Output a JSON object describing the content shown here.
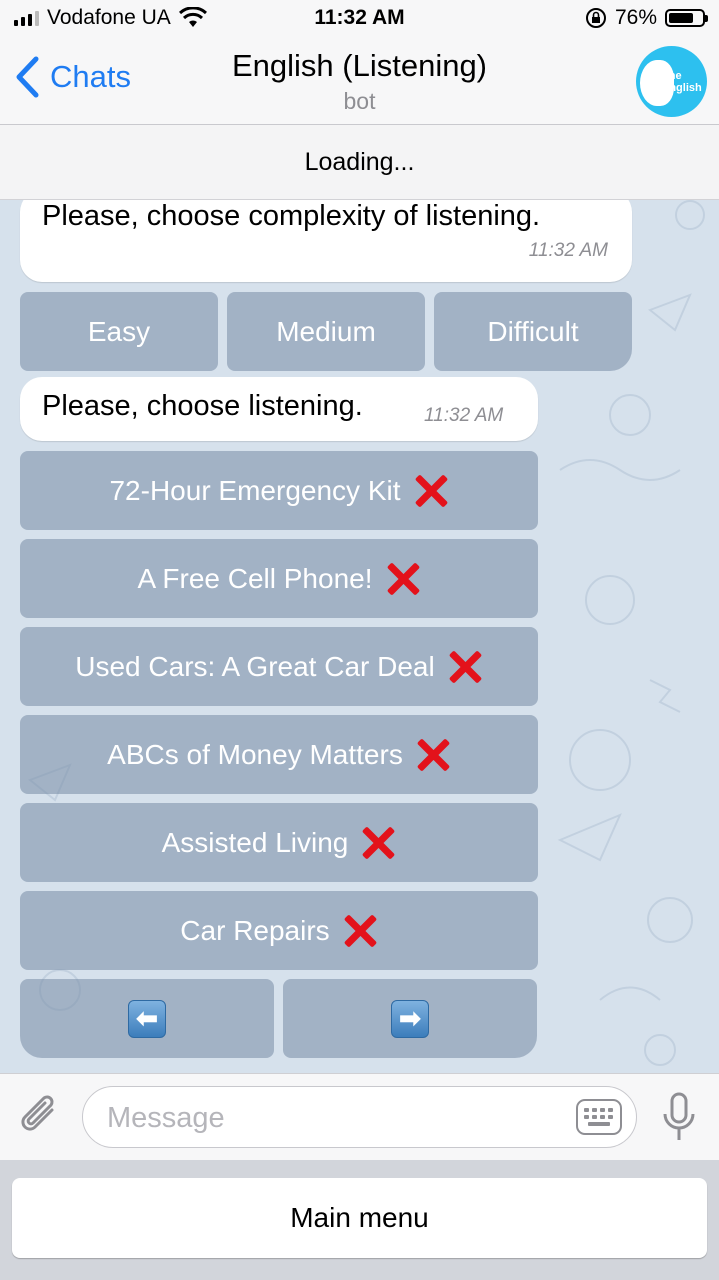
{
  "status_bar": {
    "carrier": "Vodafone UA",
    "time": "11:32 AM",
    "battery": "76%",
    "battery_level": 0.76
  },
  "nav": {
    "back_label": "Chats",
    "title": "English (Listening)",
    "subtitle": "bot",
    "avatar_text_1": "The",
    "avatar_text_2": "English"
  },
  "loading_text": "Loading...",
  "messages": [
    {
      "text": "Please, choose complexity of listening.",
      "time": "11:32 AM"
    },
    {
      "text": "Please, choose listening.",
      "time": "11:32 AM"
    }
  ],
  "complexity_buttons": [
    "Easy",
    "Medium",
    "Difficult"
  ],
  "listening_buttons": [
    "72-Hour Emergency Kit",
    "A Free Cell Phone!",
    "Used Cars: A Great Car Deal",
    "ABCs of Money Matters",
    "Assisted Living",
    "Car Repairs"
  ],
  "nav_buttons": {
    "prev_icon": "left-arrow-icon",
    "next_icon": "right-arrow-icon",
    "prev_glyph": "⬅",
    "next_glyph": "➡"
  },
  "input": {
    "placeholder": "Message"
  },
  "bottom_button": "Main menu",
  "colors": {
    "accent": "#1f7cf2",
    "chat_bg": "#d6e1ec",
    "cross": "#e3121b",
    "keyboard_button": "rgba(120,140,165,0.55)"
  }
}
